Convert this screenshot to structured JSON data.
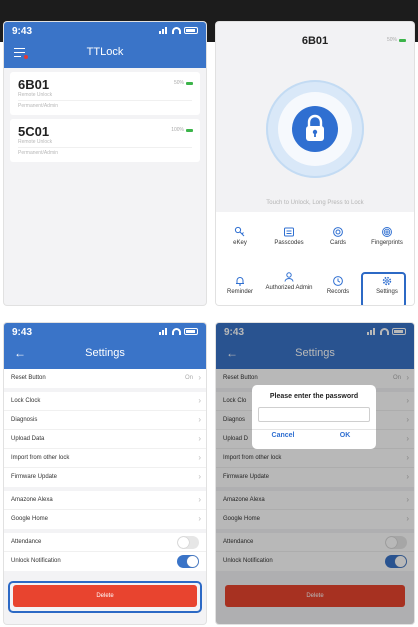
{
  "status": {
    "time": "9:43"
  },
  "panel1": {
    "title": "TTLock",
    "locks": [
      {
        "name": "6B01",
        "battery": "50%",
        "subtitle": "Remote Unlock",
        "role": "Permanent/Admin"
      },
      {
        "name": "5C01",
        "battery": "100%",
        "subtitle": "Remote Unlock",
        "role": "Permanent/Admin"
      }
    ]
  },
  "panel2": {
    "title": "6B01",
    "battery": "50%",
    "hint": "Touch to Unlock, Long Press to Lock",
    "grid": [
      {
        "label": "eKey",
        "icon": "ekey-icon"
      },
      {
        "label": "Passcodes",
        "icon": "passcode-icon"
      },
      {
        "label": "Cards",
        "icon": "card-icon"
      },
      {
        "label": "Fingerprints",
        "icon": "fingerprint-icon"
      },
      {
        "label": "Reminder",
        "icon": "bell-icon"
      },
      {
        "label": "Authorized Admin",
        "icon": "admin-icon"
      },
      {
        "label": "Records",
        "icon": "records-icon"
      },
      {
        "label": "Settings",
        "icon": "gear-icon"
      }
    ]
  },
  "settings": {
    "title": "Settings",
    "reset_button": "Reset Button",
    "reset_value": "On",
    "lock_clock": "Lock Clock",
    "diagnosis": "Diagnosis",
    "upload_data": "Upload Data",
    "import_lock": "Import from other lock",
    "firmware": "Firmware Update",
    "alexa": "Amazone Alexa",
    "google": "Google Home",
    "attendance": "Attendance",
    "unlock_notification": "Unlock Notification",
    "attendance_on": false,
    "unlock_notification_on": true,
    "delete": "Delete",
    "lock_clock_partial": "Lock Clo",
    "diagnosis_partial": "Diagnos",
    "upload_partial": "Upload D"
  },
  "dialog": {
    "title": "Please enter the password",
    "cancel": "Cancel",
    "ok": "OK"
  },
  "colors": {
    "primary": "#3a74c8",
    "danger": "#e8442f",
    "battery": "#3cb44a"
  }
}
